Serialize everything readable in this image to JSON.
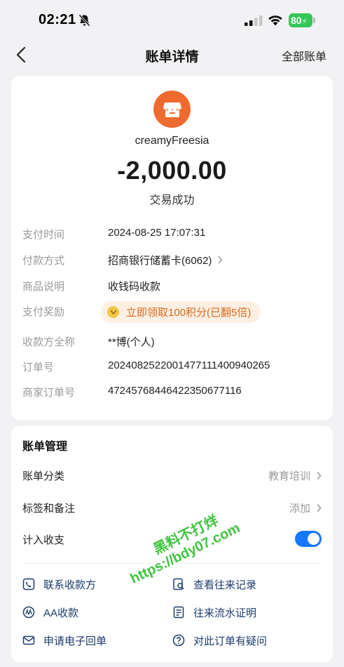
{
  "status_bar": {
    "time": "02:21",
    "battery": "80",
    "icons": [
      "bell-slash-icon",
      "signal-icon",
      "wifi-icon",
      "battery-icon"
    ]
  },
  "header": {
    "title": "账单详情",
    "right_link": "全部账单",
    "back_icon": "chevron-left-icon"
  },
  "summary": {
    "merchant_icon": "storefront-icon",
    "merchant_name": "creamyFreesia",
    "amount": "-2,000.00",
    "status": "交易成功"
  },
  "details": [
    {
      "label": "支付时间",
      "value": "2024-08-25 17:07:31"
    },
    {
      "label": "付款方式",
      "value": "招商银行储蓄卡(6062)"
    },
    {
      "label": "商品说明",
      "value": "收钱码收款"
    },
    {
      "label": "支付奖励",
      "value": "立即领取100积分(已翻5倍)"
    },
    {
      "label": "收款方全称",
      "value": "**博(个人)"
    },
    {
      "label": "订单号",
      "value": "2024082522001477111400940265"
    },
    {
      "label": "商家订单号",
      "value": "4724576844642235067711​6"
    }
  ],
  "management": {
    "title": "账单管理",
    "rows": [
      {
        "label": "账单分类",
        "value": "教育培训"
      },
      {
        "label": "标签和备注",
        "value": "添加"
      },
      {
        "label": "计入收支",
        "toggle_on": true
      }
    ],
    "actions": [
      {
        "label": "联系收款方",
        "icon": "phone-icon"
      },
      {
        "label": "查看往来记录",
        "icon": "search-record-icon"
      },
      {
        "label": "AA收款",
        "icon": "aa-icon"
      },
      {
        "label": "往来流水证明",
        "icon": "statement-icon"
      },
      {
        "label": "申请电子回单",
        "icon": "mail-icon"
      },
      {
        "label": "对此订单有疑问",
        "icon": "question-icon"
      }
    ]
  },
  "watermark": {
    "line1": "黑料不打烊",
    "line2": "https://bdy07.com"
  },
  "colors": {
    "accent": "#1677ff",
    "merchant": "#ee6a2f",
    "reward_text": "#d96a1c",
    "reward_bg": "#fdefe2",
    "battery": "#35c759"
  }
}
